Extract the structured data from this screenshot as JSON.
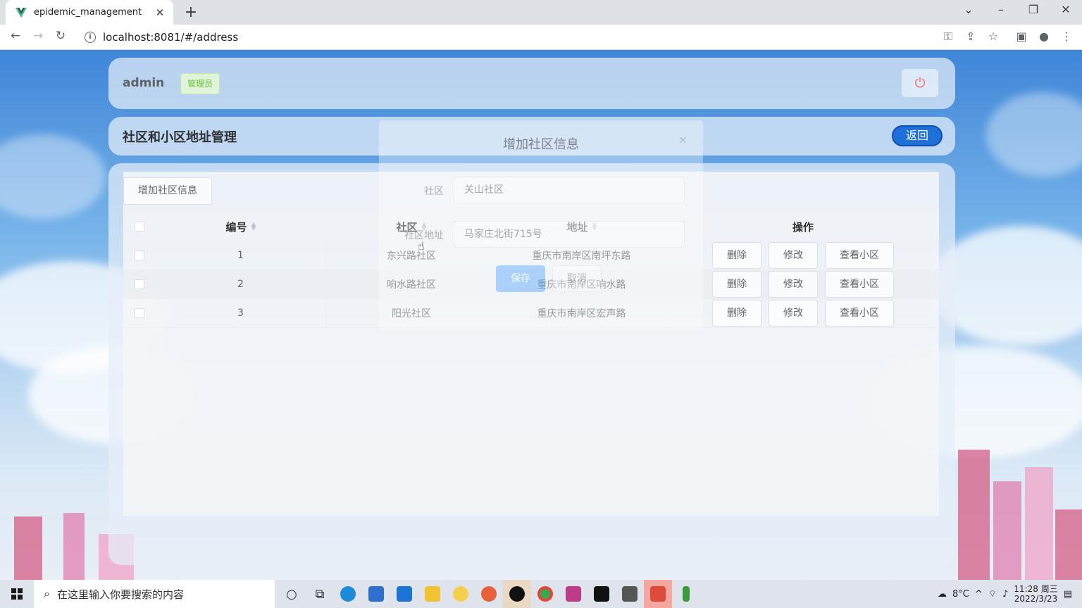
{
  "browser": {
    "tab_title": "epidemic_management",
    "url": "localhost:8081/#/address"
  },
  "header": {
    "user_name": "admin",
    "role": "管理员"
  },
  "title_bar": {
    "title": "社区和小区地址管理",
    "back_label": "返回"
  },
  "toolbar": {
    "add_label": "增加社区信息"
  },
  "table": {
    "columns": [
      "编号",
      "社区",
      "地址",
      "操作"
    ],
    "rows": [
      {
        "id": "1",
        "community": "东兴路社区",
        "address": "重庆市南岸区南坪东路"
      },
      {
        "id": "2",
        "community": "响水路社区",
        "address": "重庆市南岸区响水路"
      },
      {
        "id": "3",
        "community": "阳光社区",
        "address": "重庆市南岸区宏声路"
      }
    ],
    "actions": {
      "delete": "删除",
      "edit": "修改",
      "view": "查看小区"
    }
  },
  "modal": {
    "title": "增加社区信息",
    "close": "×",
    "community_label": "社区",
    "community_value": "关山社区",
    "address_label": "社区地址",
    "address_value": "马家庄北街715号",
    "save_label": "保存",
    "cancel_label": "取消"
  },
  "taskbar": {
    "search_placeholder": "在这里输入你要搜索的内容",
    "weather": "8°C",
    "time": "11:28 周三",
    "date": "2022/3/23"
  },
  "colors": {
    "primary": "#1f6fd8",
    "danger": "#f56c6c",
    "success": "#67c23a"
  }
}
